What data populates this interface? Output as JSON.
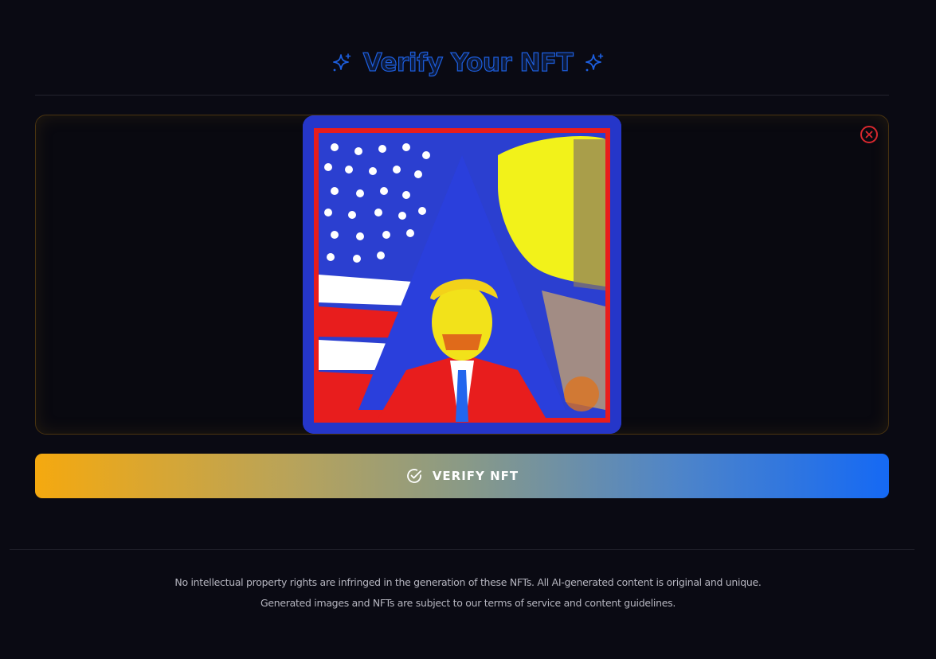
{
  "header": {
    "title": "Verify Your NFT",
    "left_icon": "sparkles-icon",
    "right_icon": "sparkles-icon",
    "title_color": "#1d5fe0"
  },
  "upload": {
    "close_icon": "close-circle-icon",
    "image_description_icon": "nft-image",
    "border_color": "#4a3410",
    "close_color": "#d8282e"
  },
  "verify_button": {
    "label": "VERIFY NFT",
    "icon": "check-circle-icon",
    "gradient_start": "#f5a90f",
    "gradient_end": "#1569f4"
  },
  "footer": {
    "line1": "No intellectual property rights are infringed in the generation of these NFTs. All AI-generated content is original and unique.",
    "line2": "Generated images and NFTs are subject to our terms of service and content guidelines."
  }
}
